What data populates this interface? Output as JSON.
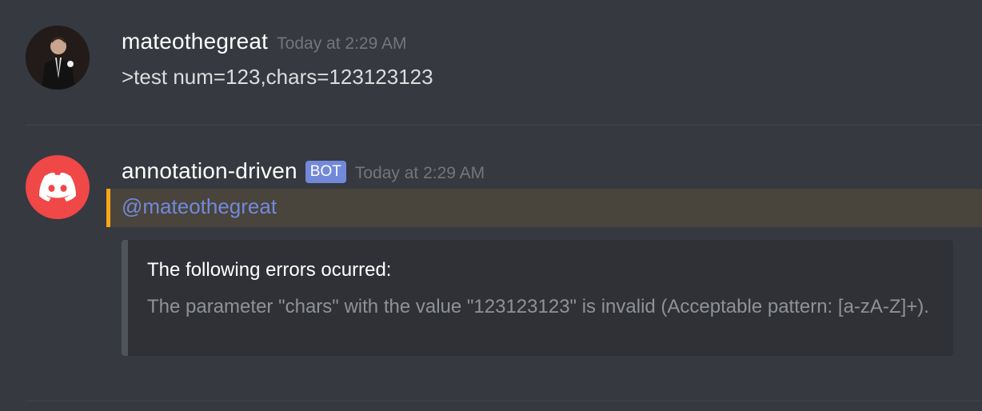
{
  "messages": [
    {
      "author": "mateothegreat",
      "timestamp": "Today at 2:29 AM",
      "text": ">test num=123,chars=123123123",
      "avatar_icon": "user-photo-avatar"
    },
    {
      "author": "annotation-driven",
      "bot_tag": "BOT",
      "timestamp": "Today at 2:29 AM",
      "mention": "@mateothegreat",
      "avatar_icon": "discord-logo-icon",
      "embed": {
        "title": "The following errors ocurred:",
        "description": "The parameter \"chars\" with the value \"123123123\" is invalid (Acceptable pattern: [a-zA-Z]+)."
      }
    }
  ],
  "colors": {
    "background": "#36393f",
    "bot_tag": "#7289da",
    "mention_highlight": "#49443c",
    "mention_bar": "#faa61a",
    "embed_background": "#2f3136",
    "discord_avatar": "#f04747"
  }
}
